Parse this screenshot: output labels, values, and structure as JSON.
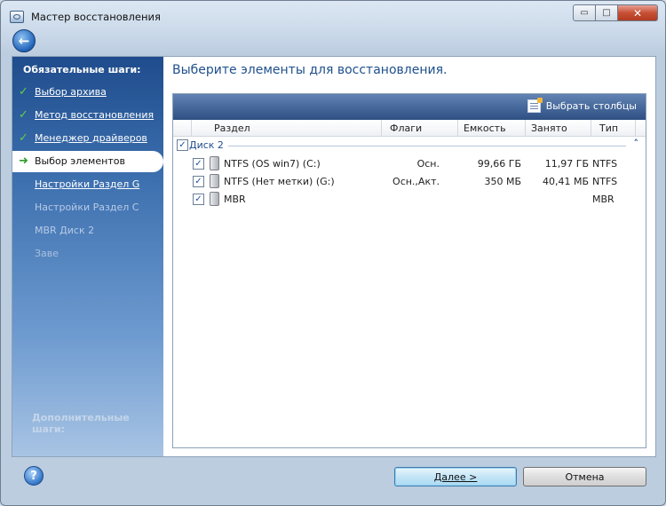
{
  "window": {
    "title": "Мастер восстановления",
    "controls": {
      "minimize": "▭",
      "maximize": "□",
      "close": "✕"
    }
  },
  "navigation": {
    "back_icon": "back-arrow-icon",
    "back_glyph": "←"
  },
  "sidebar": {
    "header": "Обязательные шаги:",
    "items": [
      {
        "label": "Выбор архива",
        "state": "done",
        "mark": "✓"
      },
      {
        "label": "Метод восстановления",
        "state": "done",
        "mark": "✓"
      },
      {
        "label": "Менеджер драйверов",
        "state": "done",
        "mark": "✓"
      },
      {
        "label": "Выбор элементов",
        "state": "current",
        "mark": "➜"
      },
      {
        "label": "Настройки Раздел G",
        "state": "pending"
      },
      {
        "label": "Настройки Раздел C",
        "state": "disabled"
      },
      {
        "label": "MBR Диск 2",
        "state": "disabled"
      },
      {
        "label": "Заве",
        "state": "disabled"
      }
    ],
    "optional_header": "Дополнительные шаги:"
  },
  "main": {
    "title": "Выберите элементы для восстановления.",
    "toolbar": {
      "select_columns": "Выбрать столбцы"
    },
    "columns": [
      "Раздел",
      "Флаги",
      "Емкость",
      "Занято",
      "Тип"
    ],
    "group": {
      "label": "Диск 2",
      "checked": true,
      "collapse_glyph": "˄"
    },
    "rows": [
      {
        "name": "NTFS (OS win7) (C:)",
        "flags": "Осн.",
        "capacity": "99,66 ГБ",
        "used": "11,97 ГБ",
        "type": "NTFS",
        "checked": true
      },
      {
        "name": "NTFS (Нет метки) (G:)",
        "flags": "Осн.,Акт.",
        "capacity": "350 МБ",
        "used": "40,41 МБ",
        "type": "NTFS",
        "checked": true
      },
      {
        "name": "MBR",
        "flags": "",
        "capacity": "",
        "used": "",
        "type": "MBR",
        "checked": true
      }
    ]
  },
  "footer": {
    "help_glyph": "?",
    "next_label": "Далее >",
    "cancel_label": "Отмена"
  },
  "colors": {
    "accent": "#1e4f8c",
    "sidebar_top": "#1f4c8c",
    "check_green": "#5fd047"
  }
}
